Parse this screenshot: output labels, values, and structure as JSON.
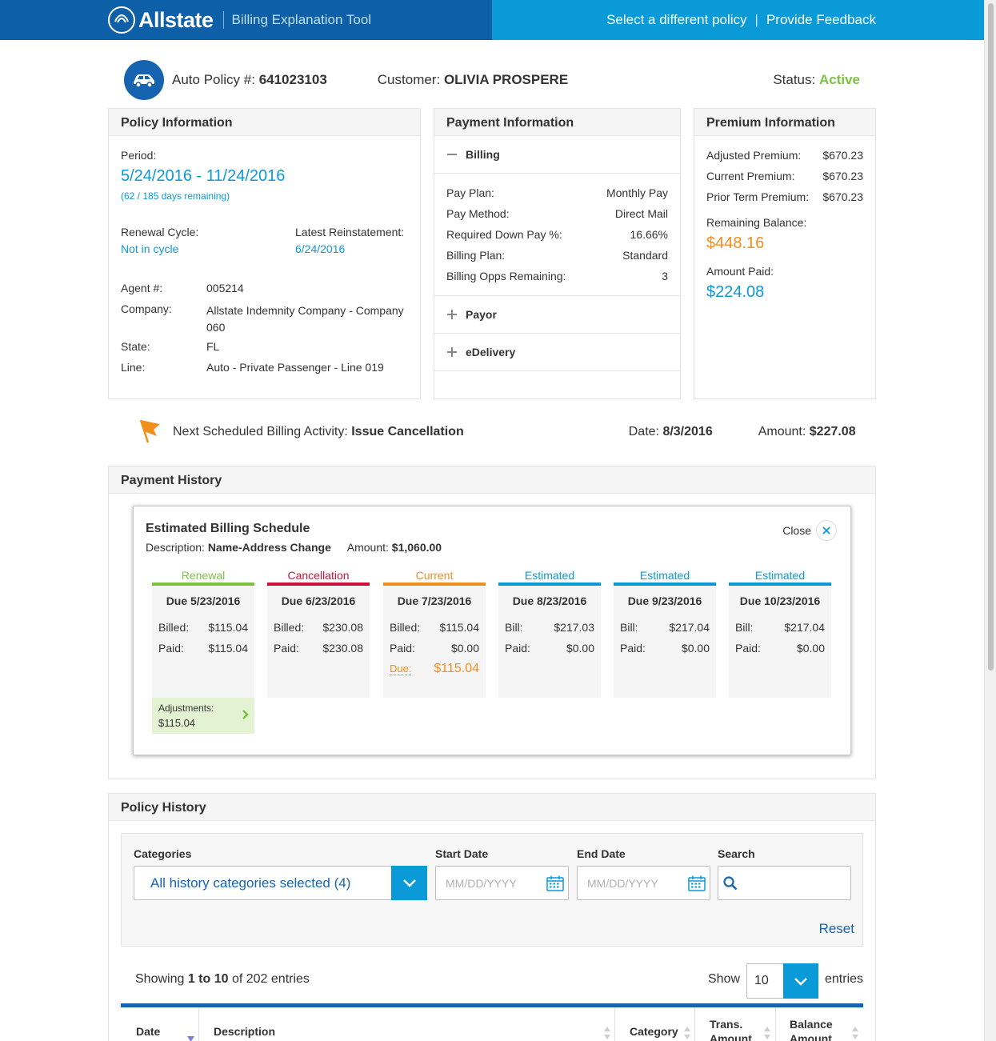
{
  "header": {
    "brand": "Allstate",
    "tool_name": "Billing Explanation Tool",
    "select_policy": "Select a different policy",
    "separator": "|",
    "feedback": "Provide Feedback"
  },
  "policy": {
    "policy_label": "Auto Policy #:",
    "policy_number": "641023103",
    "customer_label": "Customer:",
    "customer_name": "OLIVIA PROSPERE",
    "status_label": "Status:",
    "status_value": "Active"
  },
  "policy_info": {
    "title": "Policy Information",
    "period_label": "Period:",
    "period_value": "5/24/2016 - 11/24/2016",
    "days_remaining": "(62 / 185 days remaining)",
    "renewal_label": "Renewal Cycle:",
    "renewal_value": "Not in cycle",
    "reinstatement_label": "Latest Reinstatement:",
    "reinstatement_value": "6/24/2016",
    "agent_label": "Agent #:",
    "agent_value": "005214",
    "company_label": "Company:",
    "company_value_1": "Allstate Indemnity Company - Company",
    "company_value_2": "060",
    "state_label": "State:",
    "state_value": "FL",
    "line_label": "Line:",
    "line_value": "Auto - Private Passenger - Line 019"
  },
  "payment_info": {
    "title": "Payment Information",
    "billing_label": "Billing",
    "rows": [
      {
        "label": "Pay Plan:",
        "value": "Monthly Pay"
      },
      {
        "label": "Pay Method:",
        "value": "Direct Mail"
      },
      {
        "label": "Required Down Pay %:",
        "value": "16.66%"
      },
      {
        "label": "Billing Plan:",
        "value": "Standard"
      },
      {
        "label": "Billing Opps Remaining:",
        "value": "3"
      }
    ],
    "payor_label": "Payor",
    "edelivery_label": "eDelivery"
  },
  "premium_info": {
    "title": "Premium Information",
    "rows": [
      {
        "label": "Adjusted Premium:",
        "value": "$670.23"
      },
      {
        "label": "Current Premium:",
        "value": "$670.23"
      },
      {
        "label": "Prior Term Premium:",
        "value": "$670.23"
      }
    ],
    "remaining_label": "Remaining Balance:",
    "remaining_value": "$448.16",
    "paid_label": "Amount Paid:",
    "paid_value": "$224.08"
  },
  "next_activity": {
    "label": "Next Scheduled Billing Activity:",
    "value": "Issue Cancellation",
    "date_label": "Date:",
    "date_value": "8/3/2016",
    "amount_label": "Amount:",
    "amount_value": "$227.08"
  },
  "payment_history": {
    "title": "Payment History",
    "schedule": {
      "title": "Estimated Billing Schedule",
      "desc_label": "Description:",
      "desc_value": "Name-Address Change",
      "amount_label": "Amount:",
      "amount_value": "$1,060.00",
      "close_label": "Close",
      "columns": [
        {
          "header": "Renewal",
          "color": "#7cc242",
          "due": "Due 5/23/2016",
          "l1": "Billed:",
          "v1": "$115.04",
          "l2": "Paid:",
          "v2": "$115.04"
        },
        {
          "header": "Cancellation",
          "color": "#d0103a",
          "due": "Due 6/23/2016",
          "l1": "Billed:",
          "v1": "$230.08",
          "l2": "Paid:",
          "v2": "$230.08"
        },
        {
          "header": "Current",
          "color": "#f28e1c",
          "due": "Due 7/23/2016",
          "l1": "Billed:",
          "v1": "$115.04",
          "l2": "Paid:",
          "v2": "$0.00",
          "due_label": "Due:",
          "due_amount": "$115.04"
        },
        {
          "header": "Estimated",
          "color": "#0a9ad8",
          "due": "Due 8/23/2016",
          "l1": "Bill:",
          "v1": "$217.03",
          "l2": "Paid:",
          "v2": "$0.00"
        },
        {
          "header": "Estimated",
          "color": "#0a9ad8",
          "due": "Due 9/23/2016",
          "l1": "Bill:",
          "v1": "$217.04",
          "l2": "Paid:",
          "v2": "$0.00"
        },
        {
          "header": "Estimated",
          "color": "#0a9ad8",
          "due": "Due 10/23/2016",
          "l1": "Bill:",
          "v1": "$217.04",
          "l2": "Paid:",
          "v2": "$0.00"
        }
      ],
      "adjustments_label": "Adjustments:",
      "adjustments_value": "$115.04"
    }
  },
  "policy_history": {
    "title": "Policy History",
    "categories_label": "Categories",
    "categories_value": "All history categories selected (4)",
    "start_label": "Start Date",
    "start_placeholder": "MM/DD/YYYY",
    "end_label": "End Date",
    "end_placeholder": "MM/DD/YYYY",
    "search_label": "Search",
    "reset_label": "Reset",
    "showing_prefix": "Showing",
    "showing_range": "1 to 10",
    "showing_suffix": "of 202 entries",
    "show_label": "Show",
    "show_value": "10",
    "entries_label": "entries",
    "columns": {
      "date": "Date",
      "description": "Description",
      "category": "Category",
      "trans_amount_1": "Trans.",
      "trans_amount_2": "Amount",
      "balance_amount_1": "Balance",
      "balance_amount_2": "Amount"
    }
  },
  "colors": {
    "header_dark": "#0d5fa8",
    "header_light": "#0a9ad8",
    "accent_blue": "#0a9ad8",
    "accent_orange": "#f28e1c",
    "active_green": "#7cc242"
  }
}
